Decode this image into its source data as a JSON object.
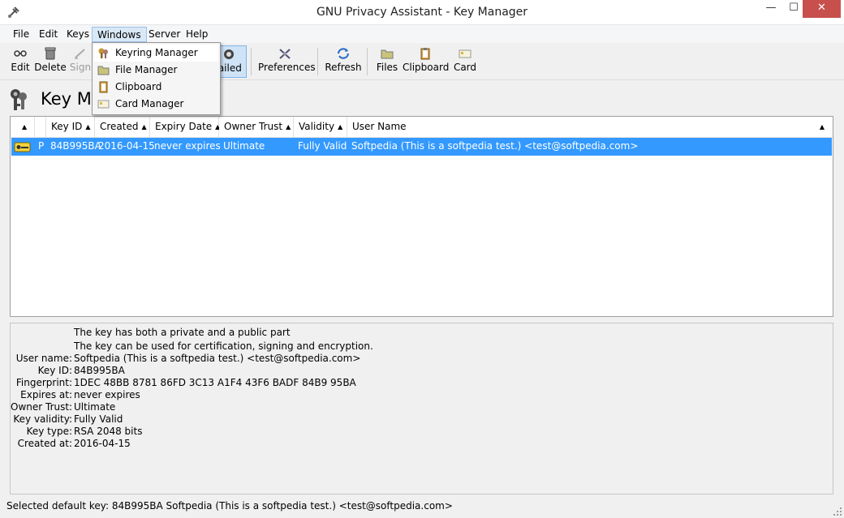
{
  "window": {
    "title": "GNU Privacy Assistant - Key Manager",
    "minimize_glyph": "—",
    "maximize_glyph": "☐",
    "close_glyph": "✕"
  },
  "menubar": {
    "items": [
      {
        "label": "File"
      },
      {
        "label": "Edit"
      },
      {
        "label": "Keys"
      },
      {
        "label": "Windows"
      },
      {
        "label": "Server"
      },
      {
        "label": "Help"
      }
    ]
  },
  "toolbar": {
    "buttons": [
      {
        "label": "Edit",
        "icon": "key-edit-icon"
      },
      {
        "label": "Delete",
        "icon": "trash-icon"
      },
      {
        "label": "Sign",
        "icon": "sign-icon"
      },
      {
        "label": "tailed",
        "icon": "detailed-icon"
      },
      {
        "label": "Preferences",
        "icon": "preferences-icon"
      },
      {
        "label": "Refresh",
        "icon": "refresh-icon"
      },
      {
        "label": "Files",
        "icon": "folder-icon"
      },
      {
        "label": "Clipboard",
        "icon": "clipboard-icon"
      },
      {
        "label": "Card",
        "icon": "card-icon"
      }
    ]
  },
  "heading": {
    "text": "Key Ma"
  },
  "windows_menu": {
    "items": [
      {
        "label": "Keyring Manager",
        "icon": "keyring-icon"
      },
      {
        "label": "File Manager",
        "icon": "file-manager-icon"
      },
      {
        "label": "Clipboard",
        "icon": "clipboard-icon"
      },
      {
        "label": "Card Manager",
        "icon": "card-icon"
      }
    ]
  },
  "keylist": {
    "columns": [
      "",
      "Key ID",
      "Created",
      "Expiry Date",
      "Owner Trust",
      "Validity",
      "User Name"
    ],
    "rows": [
      {
        "type": "P",
        "key_id": "84B995BA",
        "created": "2016-04-15",
        "expiry": "never expires",
        "owner_trust": "Ultimate",
        "validity": "Fully Valid",
        "user_name": "Softpedia (This is a softpedia test.) <test@softpedia.com>"
      }
    ]
  },
  "details": {
    "line1": "The key has both a private and a public part",
    "line2": "The key can be used for certification, signing and encryption.",
    "fields": [
      {
        "label": "User name:",
        "value": "Softpedia (This is a softpedia test.) <test@softpedia.com>"
      },
      {
        "label": "Key ID:",
        "value": "84B995BA"
      },
      {
        "label": "Fingerprint:",
        "value": "1DEC 48BB 8781 86FD 3C13  A1F4 43F6 BADF 84B9 95BA"
      },
      {
        "label": "Expires at:",
        "value": "never expires"
      },
      {
        "label": "Owner Trust:",
        "value": "Ultimate"
      },
      {
        "label": "Key validity:",
        "value": "Fully Valid"
      },
      {
        "label": "Key type:",
        "value": "RSA 2048 bits"
      },
      {
        "label": "Created at:",
        "value": "2016-04-15"
      }
    ]
  },
  "statusbar": {
    "text": "Selected default key:  84B995BA  Softpedia (This is a softpedia test.) <test@softpedia.com>"
  },
  "colors": {
    "selection": "#3399ff",
    "close_button": "#c7504c"
  }
}
